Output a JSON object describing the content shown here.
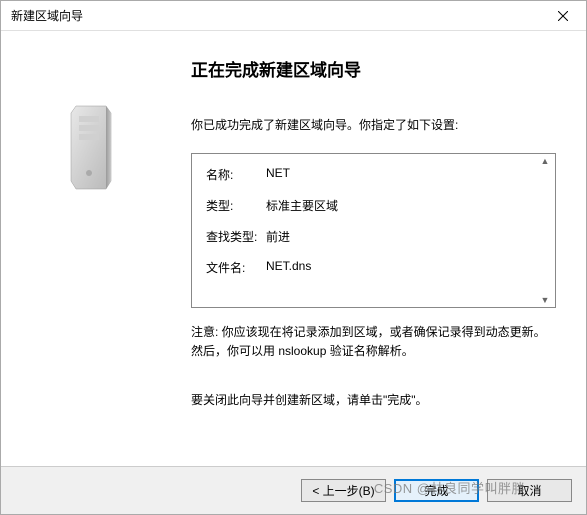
{
  "window": {
    "title": "新建区域向导"
  },
  "content": {
    "heading": "正在完成新建区域向导",
    "intro": "你已成功完成了新建区域向导。你指定了如下设置:",
    "settings": {
      "name_label": "名称:",
      "name_value": "NET",
      "type_label": "类型:",
      "type_value": "标准主要区域",
      "lookup_label": "查找类型:",
      "lookup_value": "前进",
      "file_label": "文件名:",
      "file_value": "NET.dns"
    },
    "note": "注意: 你应该现在将记录添加到区域，或者确保记录得到动态更新。然后，你可以用 nslookup 验证名称解析。",
    "closing": "要关闭此向导并创建新区域，请单击\"完成\"。"
  },
  "buttons": {
    "back": "< 上一步(B)",
    "finish": "完成",
    "cancel": "取消"
  },
  "watermark": "CSDN @林良同学叫胖胖"
}
